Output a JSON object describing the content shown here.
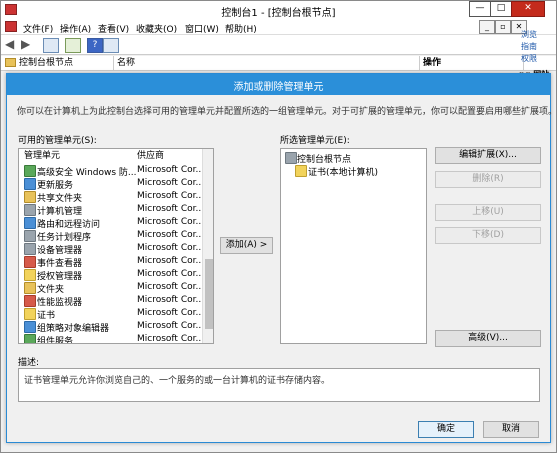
{
  "mmc": {
    "title": "控制台1 - [控制台根节点]",
    "window_buttons": {
      "minimize": "—",
      "maximize": "□",
      "close": "✕"
    },
    "menu": [
      "文件(F)",
      "操作(A)",
      "查看(V)",
      "收藏夹(O)",
      "窗口(W)",
      "帮助(H)"
    ],
    "mdi_buttons": [
      "_",
      "▫",
      "✕"
    ],
    "header": {
      "tree": "控制台根节点",
      "name": "名称",
      "actions": "操作"
    },
    "right_edge": [
      "浏览",
      "指南",
      "权限",
      "ng 网站"
    ]
  },
  "dialog": {
    "title": "添加或删除管理单元",
    "description": "你可以在计算机上为此控制台选择可用的管理单元并配置所选的一组管理单元。对于可扩展的管理单元，你可以配置要启用哪些扩展项。",
    "available_label": "可用的管理单元(S):",
    "columns": {
      "snapin": "管理单元",
      "vendor": "供应商"
    },
    "available_items": [
      {
        "name": "高级安全 Windows 防...",
        "vendor": "Microsoft Cor...",
        "icon": "firewall-icon"
      },
      {
        "name": "更新服务",
        "vendor": "Microsoft Cor...",
        "icon": "update-icon"
      },
      {
        "name": "共享文件夹",
        "vendor": "Microsoft Cor...",
        "icon": "shared-folder-icon"
      },
      {
        "name": "计算机管理",
        "vendor": "Microsoft Cor...",
        "icon": "computer-management-icon"
      },
      {
        "name": "路由和远程访问",
        "vendor": "Microsoft Cor...",
        "icon": "routing-icon"
      },
      {
        "name": "任务计划程序",
        "vendor": "Microsoft Cor...",
        "icon": "task-scheduler-icon"
      },
      {
        "name": "设备管理器",
        "vendor": "Microsoft Cor...",
        "icon": "device-manager-icon"
      },
      {
        "name": "事件查看器",
        "vendor": "Microsoft Cor...",
        "icon": "event-viewer-icon"
      },
      {
        "name": "授权管理器",
        "vendor": "Microsoft Cor...",
        "icon": "authorization-icon"
      },
      {
        "name": "文件夹",
        "vendor": "Microsoft Cor...",
        "icon": "folder-icon"
      },
      {
        "name": "性能监视器",
        "vendor": "Microsoft Cor...",
        "icon": "performance-icon"
      },
      {
        "name": "证书",
        "vendor": "Microsoft Cor...",
        "icon": "certificate-icon"
      },
      {
        "name": "组策略对象编辑器",
        "vendor": "Microsoft Cor...",
        "icon": "group-policy-icon"
      },
      {
        "name": "组件服务",
        "vendor": "Microsoft Cor...",
        "icon": "component-services-icon"
      }
    ],
    "add_button": "添加(A) >",
    "selected_label": "所选管理单元(E):",
    "selected_items": [
      {
        "name": "控制台根节点",
        "level": 0,
        "icon": "console-root-icon"
      },
      {
        "name": "证书(本地计算机)",
        "level": 1,
        "icon": "certificate-icon"
      }
    ],
    "buttons": {
      "edit_extensions": "编辑扩展(X)...",
      "remove": "删除(R)",
      "move_up": "上移(U)",
      "move_down": "下移(D)",
      "advanced": "高级(V)..."
    },
    "desc_label": "描述:",
    "desc_text": "证书管理单元允许你浏览自己的、一个服务的或一台计算机的证书存储内容。",
    "ok": "确定",
    "cancel": "取消"
  }
}
